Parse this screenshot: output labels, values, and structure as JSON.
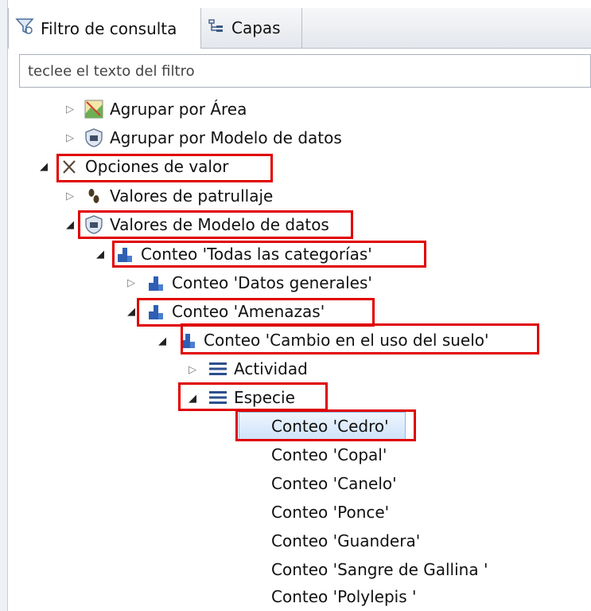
{
  "tabs": {
    "filter_tab": "Filtro de consulta",
    "layers_tab": "Capas"
  },
  "filter": {
    "placeholder": "teclee el texto del filtro"
  },
  "tree": {
    "group_area": "Agrupar por Área",
    "group_model": "Agrupar por Modelo de datos",
    "value_options": "Opciones de valor",
    "patrol_values": "Valores de patrullaje",
    "model_values": "Valores de Modelo de datos",
    "count_all": "Conteo 'Todas las categorías'",
    "count_general": "Conteo 'Datos generales'",
    "count_threats": "Conteo 'Amenazas'",
    "count_landuse": "Conteo 'Cambio en el uso del suelo'",
    "activity": "Actividad",
    "species": "Especie",
    "species_items": [
      "Conteo 'Cedro'",
      "Conteo 'Copal'",
      "Conteo 'Canelo'",
      "Conteo 'Ponce'",
      "Conteo 'Guandera'",
      "Conteo 'Sangre de Gallina '",
      "Conteo 'Polylepis '"
    ]
  },
  "icons": {
    "filter_tab": "funnel-icon",
    "layers_tab": "layers-icon",
    "area": "map-icon",
    "model": "shield-icon",
    "options": "x-icon",
    "patrol": "footprint-icon",
    "count": "bar-icon",
    "list": "list-icon"
  },
  "colors": {
    "highlight": "#e00000",
    "selection": "#cfe3fb",
    "bar_icon": "#2f5fb3"
  }
}
